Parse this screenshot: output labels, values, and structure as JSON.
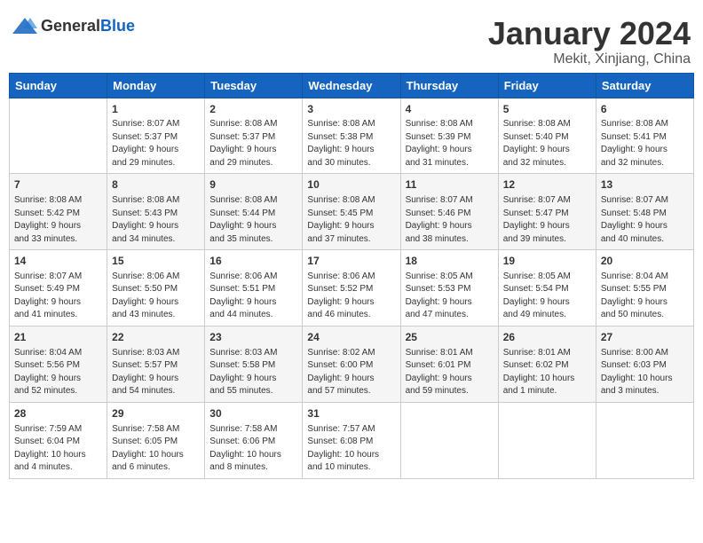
{
  "header": {
    "logo_general": "General",
    "logo_blue": "Blue",
    "month_title": "January 2024",
    "location": "Mekit, Xinjiang, China"
  },
  "columns": [
    "Sunday",
    "Monday",
    "Tuesday",
    "Wednesday",
    "Thursday",
    "Friday",
    "Saturday"
  ],
  "weeks": [
    [
      {
        "day": "",
        "content": ""
      },
      {
        "day": "1",
        "content": "Sunrise: 8:07 AM\nSunset: 5:37 PM\nDaylight: 9 hours\nand 29 minutes."
      },
      {
        "day": "2",
        "content": "Sunrise: 8:08 AM\nSunset: 5:37 PM\nDaylight: 9 hours\nand 29 minutes."
      },
      {
        "day": "3",
        "content": "Sunrise: 8:08 AM\nSunset: 5:38 PM\nDaylight: 9 hours\nand 30 minutes."
      },
      {
        "day": "4",
        "content": "Sunrise: 8:08 AM\nSunset: 5:39 PM\nDaylight: 9 hours\nand 31 minutes."
      },
      {
        "day": "5",
        "content": "Sunrise: 8:08 AM\nSunset: 5:40 PM\nDaylight: 9 hours\nand 32 minutes."
      },
      {
        "day": "6",
        "content": "Sunrise: 8:08 AM\nSunset: 5:41 PM\nDaylight: 9 hours\nand 32 minutes."
      }
    ],
    [
      {
        "day": "7",
        "content": "Sunrise: 8:08 AM\nSunset: 5:42 PM\nDaylight: 9 hours\nand 33 minutes."
      },
      {
        "day": "8",
        "content": "Sunrise: 8:08 AM\nSunset: 5:43 PM\nDaylight: 9 hours\nand 34 minutes."
      },
      {
        "day": "9",
        "content": "Sunrise: 8:08 AM\nSunset: 5:44 PM\nDaylight: 9 hours\nand 35 minutes."
      },
      {
        "day": "10",
        "content": "Sunrise: 8:08 AM\nSunset: 5:45 PM\nDaylight: 9 hours\nand 37 minutes."
      },
      {
        "day": "11",
        "content": "Sunrise: 8:07 AM\nSunset: 5:46 PM\nDaylight: 9 hours\nand 38 minutes."
      },
      {
        "day": "12",
        "content": "Sunrise: 8:07 AM\nSunset: 5:47 PM\nDaylight: 9 hours\nand 39 minutes."
      },
      {
        "day": "13",
        "content": "Sunrise: 8:07 AM\nSunset: 5:48 PM\nDaylight: 9 hours\nand 40 minutes."
      }
    ],
    [
      {
        "day": "14",
        "content": "Sunrise: 8:07 AM\nSunset: 5:49 PM\nDaylight: 9 hours\nand 41 minutes."
      },
      {
        "day": "15",
        "content": "Sunrise: 8:06 AM\nSunset: 5:50 PM\nDaylight: 9 hours\nand 43 minutes."
      },
      {
        "day": "16",
        "content": "Sunrise: 8:06 AM\nSunset: 5:51 PM\nDaylight: 9 hours\nand 44 minutes."
      },
      {
        "day": "17",
        "content": "Sunrise: 8:06 AM\nSunset: 5:52 PM\nDaylight: 9 hours\nand 46 minutes."
      },
      {
        "day": "18",
        "content": "Sunrise: 8:05 AM\nSunset: 5:53 PM\nDaylight: 9 hours\nand 47 minutes."
      },
      {
        "day": "19",
        "content": "Sunrise: 8:05 AM\nSunset: 5:54 PM\nDaylight: 9 hours\nand 49 minutes."
      },
      {
        "day": "20",
        "content": "Sunrise: 8:04 AM\nSunset: 5:55 PM\nDaylight: 9 hours\nand 50 minutes."
      }
    ],
    [
      {
        "day": "21",
        "content": "Sunrise: 8:04 AM\nSunset: 5:56 PM\nDaylight: 9 hours\nand 52 minutes."
      },
      {
        "day": "22",
        "content": "Sunrise: 8:03 AM\nSunset: 5:57 PM\nDaylight: 9 hours\nand 54 minutes."
      },
      {
        "day": "23",
        "content": "Sunrise: 8:03 AM\nSunset: 5:58 PM\nDaylight: 9 hours\nand 55 minutes."
      },
      {
        "day": "24",
        "content": "Sunrise: 8:02 AM\nSunset: 6:00 PM\nDaylight: 9 hours\nand 57 minutes."
      },
      {
        "day": "25",
        "content": "Sunrise: 8:01 AM\nSunset: 6:01 PM\nDaylight: 9 hours\nand 59 minutes."
      },
      {
        "day": "26",
        "content": "Sunrise: 8:01 AM\nSunset: 6:02 PM\nDaylight: 10 hours\nand 1 minute."
      },
      {
        "day": "27",
        "content": "Sunrise: 8:00 AM\nSunset: 6:03 PM\nDaylight: 10 hours\nand 3 minutes."
      }
    ],
    [
      {
        "day": "28",
        "content": "Sunrise: 7:59 AM\nSunset: 6:04 PM\nDaylight: 10 hours\nand 4 minutes."
      },
      {
        "day": "29",
        "content": "Sunrise: 7:58 AM\nSunset: 6:05 PM\nDaylight: 10 hours\nand 6 minutes."
      },
      {
        "day": "30",
        "content": "Sunrise: 7:58 AM\nSunset: 6:06 PM\nDaylight: 10 hours\nand 8 minutes."
      },
      {
        "day": "31",
        "content": "Sunrise: 7:57 AM\nSunset: 6:08 PM\nDaylight: 10 hours\nand 10 minutes."
      },
      {
        "day": "",
        "content": ""
      },
      {
        "day": "",
        "content": ""
      },
      {
        "day": "",
        "content": ""
      }
    ]
  ]
}
